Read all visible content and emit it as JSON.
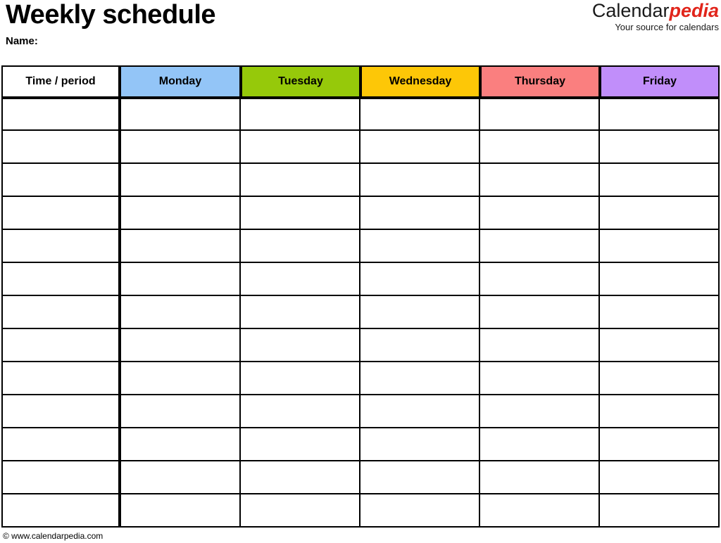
{
  "document": {
    "title": "Weekly schedule",
    "name_label": "Name:",
    "footer": "© www.calendarpedia.com"
  },
  "brand": {
    "part_1": "Calendar",
    "part_2": "pedia",
    "tagline": "Your source for calendars",
    "color_part_1": "#1a1a1a",
    "color_part_2": "#e1251b"
  },
  "table": {
    "columns": [
      {
        "key": "time",
        "label": "Time / period",
        "color": "#ffffff"
      },
      {
        "key": "monday",
        "label": "Monday",
        "color": "#93c5f7"
      },
      {
        "key": "tuesday",
        "label": "Tuesday",
        "color": "#96c90a"
      },
      {
        "key": "wednesday",
        "label": "Wednesday",
        "color": "#fdc707"
      },
      {
        "key": "thursday",
        "label": "Thursday",
        "color": "#fa7f7f"
      },
      {
        "key": "friday",
        "label": "Friday",
        "color": "#c18efa"
      }
    ],
    "row_count": 13,
    "rows": [
      {
        "time": "",
        "monday": "",
        "tuesday": "",
        "wednesday": "",
        "thursday": "",
        "friday": ""
      },
      {
        "time": "",
        "monday": "",
        "tuesday": "",
        "wednesday": "",
        "thursday": "",
        "friday": ""
      },
      {
        "time": "",
        "monday": "",
        "tuesday": "",
        "wednesday": "",
        "thursday": "",
        "friday": ""
      },
      {
        "time": "",
        "monday": "",
        "tuesday": "",
        "wednesday": "",
        "thursday": "",
        "friday": ""
      },
      {
        "time": "",
        "monday": "",
        "tuesday": "",
        "wednesday": "",
        "thursday": "",
        "friday": ""
      },
      {
        "time": "",
        "monday": "",
        "tuesday": "",
        "wednesday": "",
        "thursday": "",
        "friday": ""
      },
      {
        "time": "",
        "monday": "",
        "tuesday": "",
        "wednesday": "",
        "thursday": "",
        "friday": ""
      },
      {
        "time": "",
        "monday": "",
        "tuesday": "",
        "wednesday": "",
        "thursday": "",
        "friday": ""
      },
      {
        "time": "",
        "monday": "",
        "tuesday": "",
        "wednesday": "",
        "thursday": "",
        "friday": ""
      },
      {
        "time": "",
        "monday": "",
        "tuesday": "",
        "wednesday": "",
        "thursday": "",
        "friday": ""
      },
      {
        "time": "",
        "monday": "",
        "tuesday": "",
        "wednesday": "",
        "thursday": "",
        "friday": ""
      },
      {
        "time": "",
        "monday": "",
        "tuesday": "",
        "wednesday": "",
        "thursday": "",
        "friday": ""
      },
      {
        "time": "",
        "monday": "",
        "tuesday": "",
        "wednesday": "",
        "thursday": "",
        "friday": ""
      }
    ]
  }
}
